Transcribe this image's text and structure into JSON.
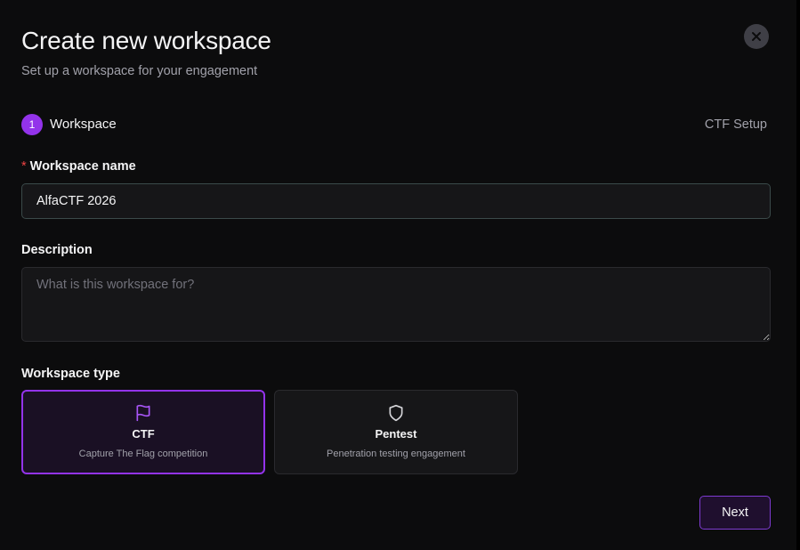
{
  "dialog": {
    "title": "Create new workspace",
    "subtitle": "Set up a workspace for your engagement",
    "close_icon": "x-icon"
  },
  "stepper": {
    "current_step_number": "1",
    "current_step_label": "Workspace",
    "next_step_label": "CTF Setup",
    "accent_color": "#9333ea"
  },
  "form": {
    "name": {
      "required_marker": "*",
      "label": "Workspace name",
      "value": "AlfaCTF 2026"
    },
    "description": {
      "label": "Description",
      "value": "",
      "placeholder": "What is this workspace for?"
    },
    "type": {
      "label": "Workspace type",
      "selected": "ctf",
      "options": [
        {
          "id": "ctf",
          "icon": "flag-icon",
          "title": "CTF",
          "description": "Capture The Flag competition"
        },
        {
          "id": "pentest",
          "icon": "shield-icon",
          "title": "Pentest",
          "description": "Penetration testing engagement"
        }
      ]
    }
  },
  "actions": {
    "next_label": "Next"
  }
}
